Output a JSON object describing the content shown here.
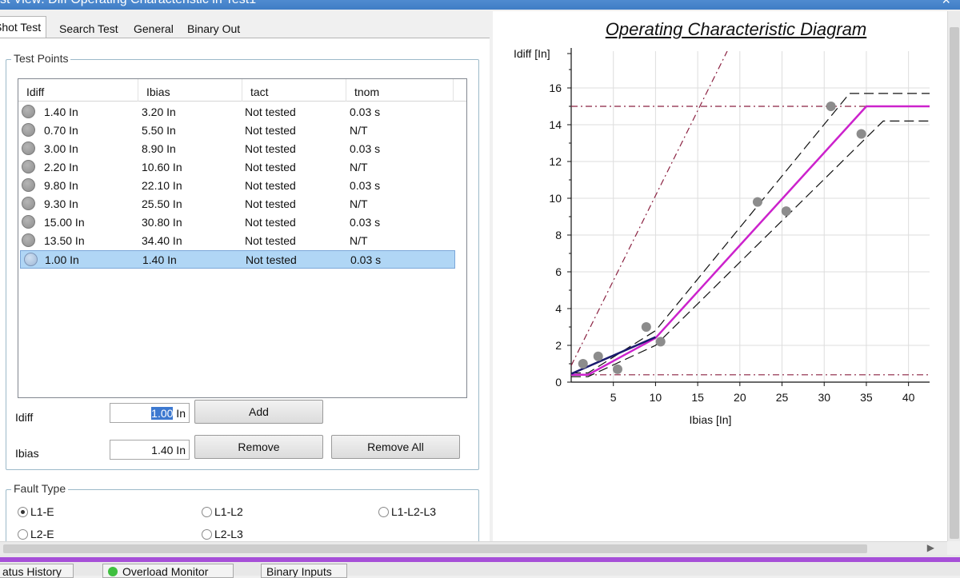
{
  "window": {
    "title": "st View: Diff Operating Characteristic in Test1",
    "close_glyph": "×"
  },
  "tabs": [
    {
      "label": "Shot Test",
      "active": true
    },
    {
      "label": "Search Test",
      "active": false
    },
    {
      "label": "General",
      "active": false
    },
    {
      "label": "Binary Out",
      "active": false
    }
  ],
  "test_points": {
    "legend": "Test Points",
    "columns": [
      "Idiff",
      "Ibias",
      "tact",
      "tnom"
    ],
    "rows": [
      {
        "idiff": "1.40 In",
        "ibias": "3.20 In",
        "tact": "Not tested",
        "tnom": "0.03 s",
        "selected": false
      },
      {
        "idiff": "0.70 In",
        "ibias": "5.50 In",
        "tact": "Not tested",
        "tnom": "N/T",
        "selected": false
      },
      {
        "idiff": "3.00 In",
        "ibias": "8.90 In",
        "tact": "Not tested",
        "tnom": "0.03 s",
        "selected": false
      },
      {
        "idiff": "2.20 In",
        "ibias": "10.60 In",
        "tact": "Not tested",
        "tnom": "N/T",
        "selected": false
      },
      {
        "idiff": "9.80 In",
        "ibias": "22.10 In",
        "tact": "Not tested",
        "tnom": "0.03 s",
        "selected": false
      },
      {
        "idiff": "9.30 In",
        "ibias": "25.50 In",
        "tact": "Not tested",
        "tnom": "N/T",
        "selected": false
      },
      {
        "idiff": "15.00 In",
        "ibias": "30.80 In",
        "tact": "Not tested",
        "tnom": "0.03 s",
        "selected": false
      },
      {
        "idiff": "13.50 In",
        "ibias": "34.40 In",
        "tact": "Not tested",
        "tnom": "N/T",
        "selected": false
      },
      {
        "idiff": "1.00 In",
        "ibias": "1.40 In",
        "tact": "Not tested",
        "tnom": "0.03 s",
        "selected": true
      }
    ]
  },
  "entry": {
    "idiff_label": "Idiff",
    "idiff_selected_text": "1.00",
    "idiff_unit": " In",
    "ibias_label": "Ibias",
    "ibias_value": "1.40 In",
    "add_label": "Add",
    "remove_label": "Remove",
    "remove_all_label": "Remove All"
  },
  "fault_type": {
    "legend": "Fault Type",
    "options": [
      {
        "label": "L1-E",
        "checked": true
      },
      {
        "label": "L1-L2",
        "checked": false
      },
      {
        "label": "L1-L2-L3",
        "checked": false
      },
      {
        "label": "L2-E",
        "checked": false
      },
      {
        "label": "L2-L3",
        "checked": false
      }
    ]
  },
  "chart_data": {
    "type": "scatter",
    "title": "Operating Characteristic Diagram",
    "xlabel": "Ibias  [In]",
    "ylabel": "Idiff  [In]",
    "xlim": [
      0,
      42.5
    ],
    "ylim": [
      0,
      18
    ],
    "xticks": [
      5,
      10,
      15,
      20,
      25,
      30,
      35,
      40
    ],
    "yticks": [
      0,
      2,
      4,
      6,
      8,
      10,
      12,
      14,
      16
    ],
    "grid": true,
    "test_points": [
      {
        "x": 3.2,
        "y": 1.4
      },
      {
        "x": 5.5,
        "y": 0.7
      },
      {
        "x": 8.9,
        "y": 3.0
      },
      {
        "x": 10.6,
        "y": 2.2
      },
      {
        "x": 22.1,
        "y": 9.8
      },
      {
        "x": 25.5,
        "y": 9.3
      },
      {
        "x": 30.8,
        "y": 15.0
      },
      {
        "x": 34.4,
        "y": 13.5
      },
      {
        "x": 1.4,
        "y": 1.0
      }
    ],
    "characteristic": [
      [
        0,
        0.4
      ],
      [
        2,
        0.4
      ],
      [
        10,
        2.4
      ],
      [
        35,
        15.0
      ],
      [
        42.5,
        15.0
      ]
    ],
    "tolerance_upper": [
      [
        0,
        0.5
      ],
      [
        2,
        0.5
      ],
      [
        10,
        2.8
      ],
      [
        33,
        15.7
      ],
      [
        42.5,
        15.7
      ]
    ],
    "tolerance_lower": [
      [
        0,
        0.3
      ],
      [
        2,
        0.3
      ],
      [
        10,
        2.0
      ],
      [
        37,
        14.2
      ],
      [
        42.5,
        14.2
      ]
    ],
    "idiff_low_threshold": 0.4,
    "idiff_high_threshold": 15.0,
    "trip_line": [
      [
        0,
        0.9
      ],
      [
        18.5,
        18
      ]
    ],
    "pickup_segment": [
      [
        0,
        0.45
      ],
      [
        10,
        2.45
      ]
    ],
    "colors": {
      "characteristic": "#cc22cc",
      "tolerance": "#111111",
      "threshold": "#8a2040",
      "pickup": "#1a1a6e",
      "points": "#8c8c8c",
      "grid": "#dedede"
    }
  },
  "status_tabs": [
    {
      "label": "atus History",
      "icon": ""
    },
    {
      "label": "Overload Monitor",
      "icon": "green-status-icon"
    },
    {
      "label": "Binary Inputs",
      "icon": ""
    }
  ]
}
